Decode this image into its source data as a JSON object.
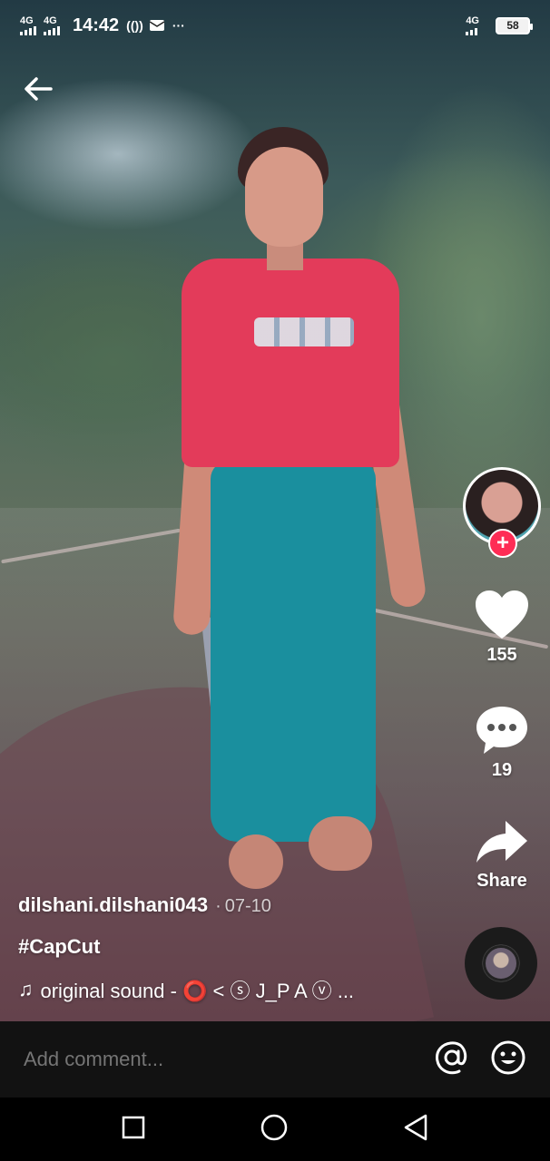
{
  "status_bar": {
    "signal1": "4G",
    "signal2": "4G",
    "time": "14:42",
    "extra": "(())",
    "more": "···",
    "network": "4G",
    "battery": "58"
  },
  "video": {
    "author": "dilshani.dilshani043",
    "date_sep": "·",
    "date": "07-10",
    "hashtag": "#CapCut",
    "sound_note": "♫",
    "sound": "original sound - ⭕ < ⓢ J_P A ⓥ ..."
  },
  "actions": {
    "likes": "155",
    "comments": "19",
    "share_label": "Share"
  },
  "comment_bar": {
    "placeholder": "Add comment..."
  },
  "icons": {
    "back": "arrow-left-icon",
    "like": "heart-icon",
    "comment": "speech-bubble-icon",
    "share": "share-arrow-icon",
    "mention": "at-sign-icon",
    "emoji": "emoji-icon",
    "follow": "plus-icon"
  },
  "colors": {
    "accent": "#fe2c55",
    "comment_bar_bg": "#121212"
  }
}
